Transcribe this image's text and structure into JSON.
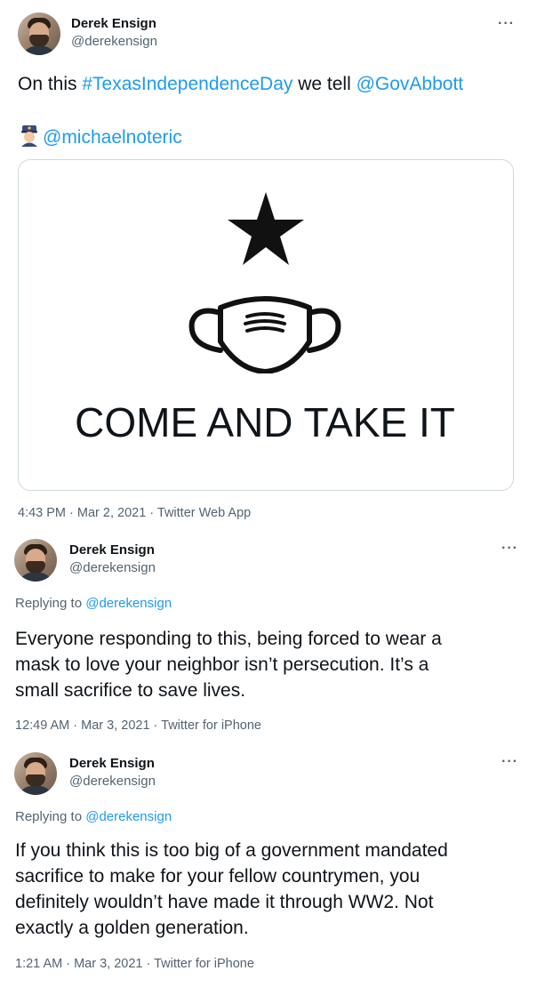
{
  "tweets": [
    {
      "author_name": "Derek Ensign",
      "author_handle": "@derekensign",
      "more": "···",
      "text_prefix": "On this ",
      "hashtag": "#TexasIndependenceDay",
      "text_middle": " we tell ",
      "mention": "@GovAbbott",
      "second_mention": "@michaelnoteric",
      "image_slogan": "COME AND TAKE IT",
      "timestamp": "4:43 PM · Mar 2, 2021 · Twitter Web App"
    },
    {
      "author_name": "Derek Ensign",
      "author_handle": "@derekensign",
      "more": "···",
      "replying_prefix": "Replying to ",
      "replying_to": "@derekensign",
      "line1": "Everyone responding to this, being forced to wear a",
      "line2": "mask to love your neighbor isn’t persecution. It’s a",
      "line3": "small sacrifice to save lives.",
      "timestamp": "12:49 AM · Mar 3, 2021 · Twitter for iPhone"
    },
    {
      "author_name": "Derek Ensign",
      "author_handle": "@derekensign",
      "more": "···",
      "replying_prefix": "Replying to ",
      "replying_to": "@derekensign",
      "line1": "If you think this is too big of a government mandated",
      "line2": "sacrifice to make for your fellow countrymen, you",
      "line3": "definitely wouldn’t have made it through WW2. Not",
      "line4": "exactly a golden generation.",
      "timestamp": "1:21 AM · Mar 3, 2021 · Twitter for iPhone"
    }
  ],
  "icons": {
    "more": "more-horizontal-icon",
    "star": "star-icon",
    "mask": "face-mask-icon",
    "emoji": "police-officer-emoji-icon"
  }
}
